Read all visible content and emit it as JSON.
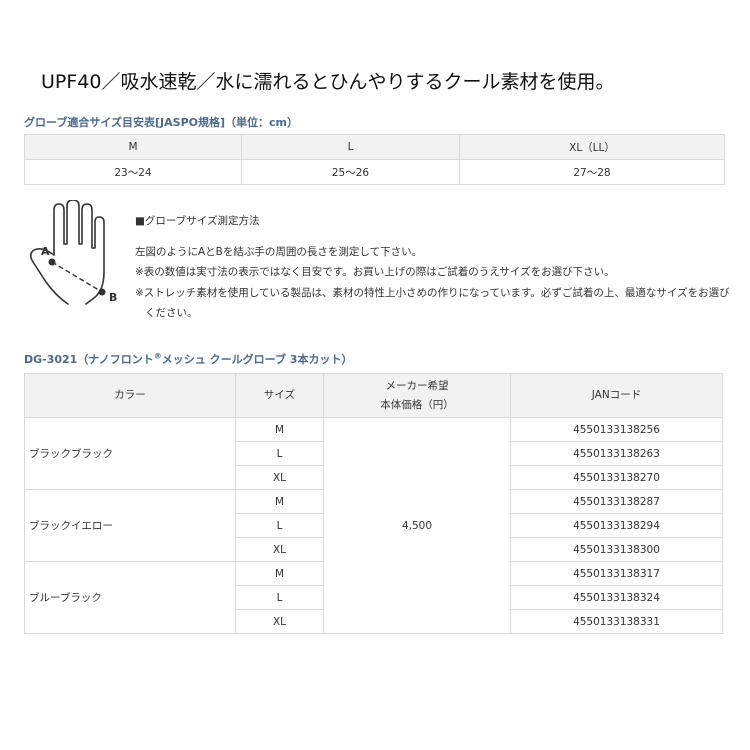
{
  "headline": "UPF40／吸水速乾／水に濡れるとひんやりするクール素材を使用。",
  "size_chart": {
    "title": "グローブ適合サイズ目安表[JASPO規格]（単位：cm）",
    "headers": [
      "M",
      "L",
      "XL（LL）"
    ],
    "values": [
      "23〜24",
      "25〜26",
      "27〜28"
    ]
  },
  "measure": {
    "label_a": "A",
    "label_b": "B",
    "heading": "■グローブサイズ測定方法",
    "line1": "左図のようにAとBを結ぶ手の周囲の長さを測定して下さい。",
    "line2": "※表の数値は実寸法の表示ではなく目安です。お買い上げの際はご試着のうえサイズをお選び下さい。",
    "line3": "※ストレッチ素材を使用している製品は、素材の特性上小さめの作りになっています。必ずご試着の上、最適なサイズをお選び",
    "line3b": "ください。"
  },
  "product": {
    "title_prefix": "DG-3021（ナノフロント",
    "title_reg": "®",
    "title_suffix": "メッシュ クールグローブ 3本カット）",
    "headers": {
      "color": "カラー",
      "size": "サイズ",
      "price_line1": "メーカー希望",
      "price_line2": "本体価格（円）",
      "jan": "JANコード"
    },
    "price": "4,500",
    "groups": [
      {
        "color": "ブラックブラック",
        "rows": [
          {
            "size": "M",
            "jan": "4550133138256"
          },
          {
            "size": "L",
            "jan": "4550133138263"
          },
          {
            "size": "XL",
            "jan": "4550133138270"
          }
        ]
      },
      {
        "color": "ブラックイエロー",
        "rows": [
          {
            "size": "M",
            "jan": "4550133138287"
          },
          {
            "size": "L",
            "jan": "4550133138294"
          },
          {
            "size": "XL",
            "jan": "4550133138300"
          }
        ]
      },
      {
        "color": "ブルーブラック",
        "rows": [
          {
            "size": "M",
            "jan": "4550133138317"
          },
          {
            "size": "L",
            "jan": "4550133138324"
          },
          {
            "size": "XL",
            "jan": "4550133138331"
          }
        ]
      }
    ]
  }
}
